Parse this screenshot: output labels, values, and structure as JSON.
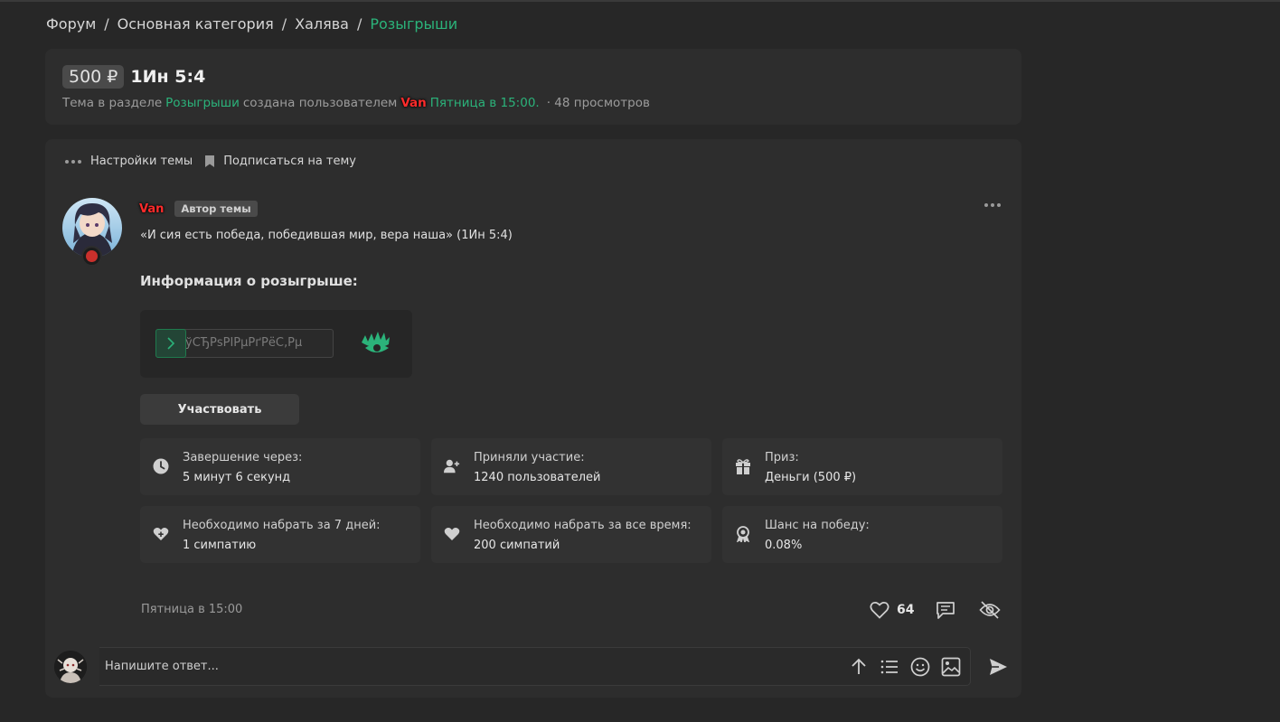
{
  "breadcrumb": {
    "items": [
      "Форум",
      "Основная категория",
      "Халява"
    ],
    "current": "Розыгрыши",
    "separator": "/"
  },
  "thread": {
    "prefix": "500 ₽",
    "title": "1Ин 5:4",
    "meta": {
      "intro": "Тема в разделе",
      "section": "Розыгрыши",
      "created_by": "создана пользователем",
      "username": "Van",
      "date": "Пятница в 15:00.",
      "views": "· 48 просмотров"
    }
  },
  "thread_tools": {
    "settings_label": "Настройки темы",
    "subscribe_label": "Подписаться на тему"
  },
  "post": {
    "username": "Van",
    "author_badge": "Автор темы",
    "quote": "«И сия есть победа, победившая мир, вера наша» (1Ин 5:4)",
    "info_title": "Информация о розыгрыше:",
    "captcha_text": "ўСЂРѕРІРµРґРёС‚Рµ",
    "participate_label": "Участвовать",
    "stats": [
      {
        "icon": "clock-icon",
        "label": "Завершение через:",
        "value": "5 минут 6 секунд"
      },
      {
        "icon": "user-plus-icon",
        "label": "Приняли участие:",
        "value": "1240 пользователей"
      },
      {
        "icon": "gift-icon",
        "label": "Приз:",
        "value": "Деньги (500 ₽)"
      },
      {
        "icon": "heart-plus-icon",
        "label": "Необходимо набрать за 7 дней:",
        "value": "1 симпатию"
      },
      {
        "icon": "heart-icon",
        "label": "Необходимо набрать за все время:",
        "value": "200 симпатий"
      },
      {
        "icon": "award-icon",
        "label": "Шанс на победу:",
        "value": "0.08%"
      }
    ],
    "date": "Пятница в 15:00",
    "like_count": "64"
  },
  "reply": {
    "placeholder": "Напишите ответ..."
  },
  "colors": {
    "accent_green": "#2bb37a",
    "username_red": "#ff2b2b",
    "background": "#272727",
    "card": "#2d2d2d"
  }
}
